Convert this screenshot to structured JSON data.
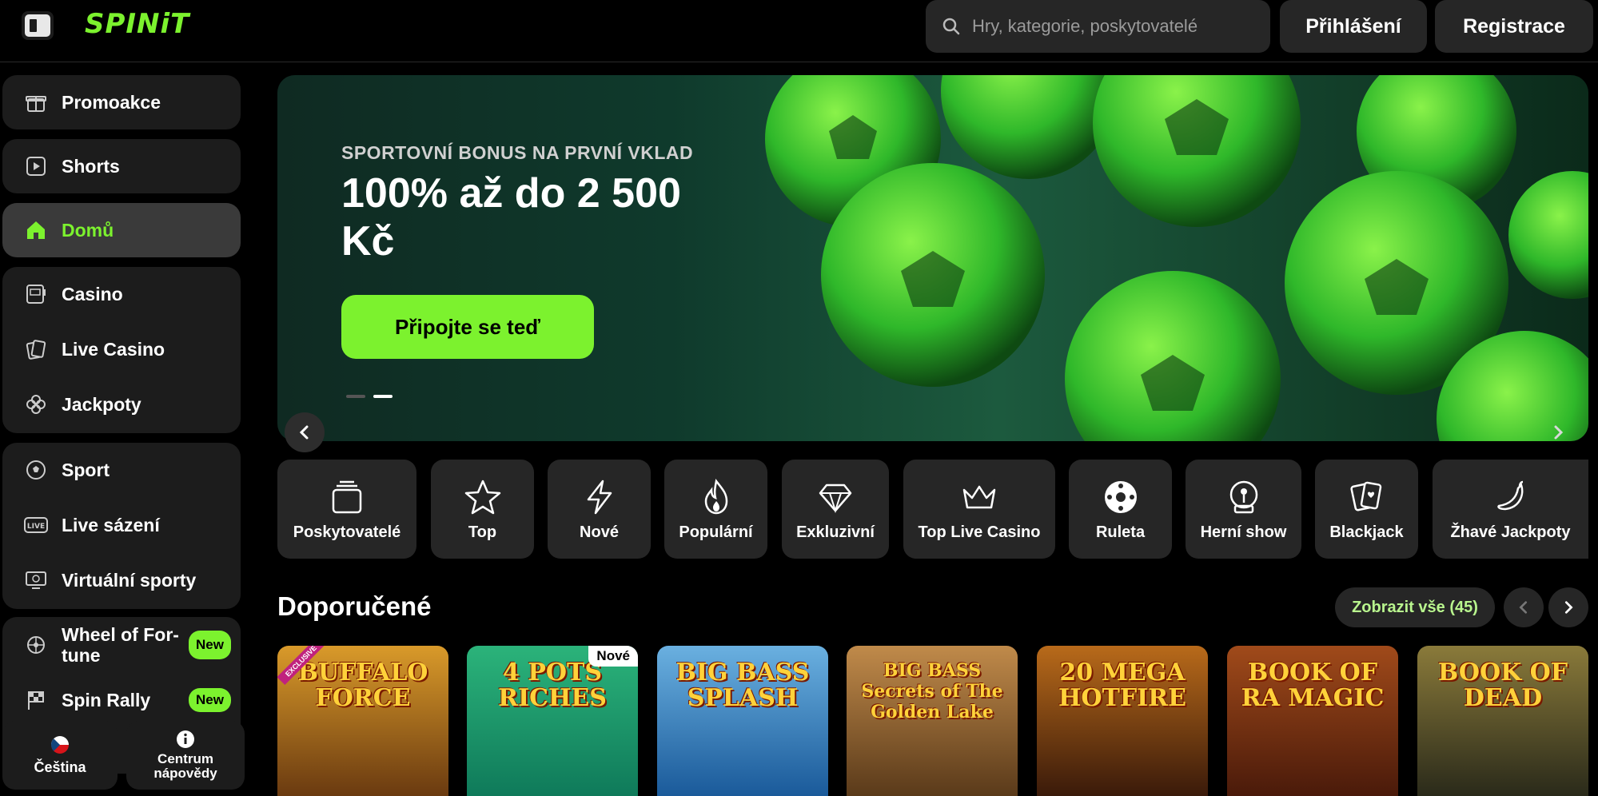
{
  "header": {
    "logo": "SPINiT",
    "search_placeholder": "Hry, kategorie, poskytovatelé",
    "login_label": "Přihlášení",
    "register_label": "Registrace"
  },
  "sidebar": {
    "items": [
      {
        "label": "Promoakce",
        "icon": "gift-icon"
      },
      {
        "label": "Shorts",
        "icon": "play-icon"
      },
      {
        "label": "Domů",
        "icon": "home-icon",
        "active": true
      },
      {
        "label": "Casino",
        "icon": "slot-machine-icon"
      },
      {
        "label": "Live Casino",
        "icon": "cards-icon"
      },
      {
        "label": "Jackpoty",
        "icon": "clover-icon"
      },
      {
        "label": "Sport",
        "icon": "soccer-ball-icon"
      },
      {
        "label": "Live sázení",
        "icon": "live-icon"
      },
      {
        "label": "Virtuální sporty",
        "icon": "monitor-ball-icon"
      },
      {
        "label": "Wheel of For-tune",
        "icon": "wheel-icon",
        "badge": "New"
      },
      {
        "label": "Spin Rally",
        "icon": "checkered-flag-icon",
        "badge": "New"
      }
    ],
    "language_label": "Čeština",
    "help_label": "Centrum nápovědy"
  },
  "hero": {
    "kicker": "SPORTOVNÍ BONUS NA PRVNÍ VKLAD",
    "title": "100% až do 2 500 Kč",
    "cta_label": "Připojte se teď"
  },
  "categories": [
    {
      "label": "Poskytovatelé",
      "icon": "stack-icon"
    },
    {
      "label": "Top",
      "icon": "star-icon"
    },
    {
      "label": "Nové",
      "icon": "lightning-icon"
    },
    {
      "label": "Populární",
      "icon": "flame-icon"
    },
    {
      "label": "Exkluzivní",
      "icon": "diamond-icon"
    },
    {
      "label": "Top Live Casino",
      "icon": "crown-icon"
    },
    {
      "label": "Ruleta",
      "icon": "roulette-icon"
    },
    {
      "label": "Herní show",
      "icon": "joystick-icon"
    },
    {
      "label": "Blackjack",
      "icon": "playing-cards-icon"
    },
    {
      "label": "Žhavé Jackpoty",
      "icon": "chili-icon"
    }
  ],
  "recommended": {
    "title": "Doporučené",
    "see_all_label": "Zobrazit vše (45)",
    "games": [
      {
        "title": "BUFFALO FORCE",
        "badge": "EXCLUSIVE",
        "colors": [
          "#6a3a10",
          "#d99a2a"
        ]
      },
      {
        "title": "4 POTS RICHES",
        "badge": "Nové",
        "colors": [
          "#0f7a5a",
          "#2bb37a"
        ]
      },
      {
        "title": "BIG BASS SPLASH",
        "colors": [
          "#1a5a9a",
          "#6ab0e0"
        ]
      },
      {
        "title": "BIG BASS Secrets of The Golden Lake",
        "colors": [
          "#5a3a1a",
          "#c08a4a"
        ]
      },
      {
        "title": "20 MEGA HOTFIRE",
        "colors": [
          "#3a1a0a",
          "#b86a1a"
        ]
      },
      {
        "title": "BOOK OF RA MAGIC",
        "colors": [
          "#4a1a0a",
          "#a04a1a"
        ]
      },
      {
        "title": "BOOK OF DEAD",
        "colors": [
          "#2a2a1a",
          "#8a7a3a"
        ]
      }
    ]
  },
  "colors": {
    "accent": "#7cf22e",
    "panel": "#1c1c1c",
    "button": "#262626"
  }
}
